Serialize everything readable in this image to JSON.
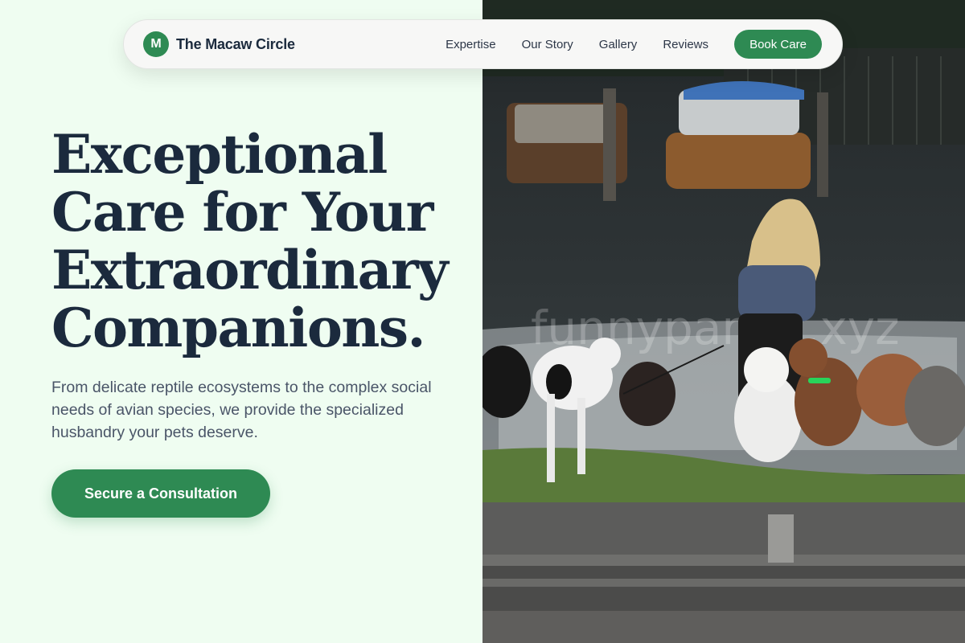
{
  "nav": {
    "logo_letter": "M",
    "brand_name": "The Macaw Circle",
    "links": [
      "Expertise",
      "Our Story",
      "Gallery",
      "Reviews"
    ],
    "cta_label": "Book Care"
  },
  "hero": {
    "headline_lines": [
      "Exceptional",
      "Care for Your",
      "Extraordinary",
      "Companions."
    ],
    "subtext": "From delicate reptile ecosystems to the complex social needs of avian species, we provide the specialized husbandry your pets deserve.",
    "cta_label": "Secure a Consultation",
    "photo_watermark": "funnyparrot.xyz"
  },
  "colors": {
    "accent": "#2e8a53",
    "heading": "#1b2a3d",
    "body_text": "#4a5568",
    "page_bg": "#effdf1"
  }
}
